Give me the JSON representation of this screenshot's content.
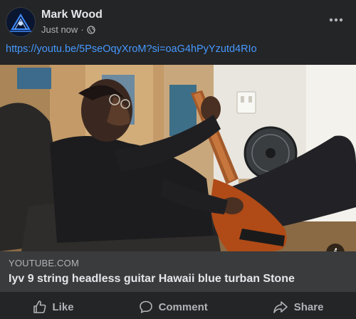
{
  "post": {
    "author": "Mark Wood",
    "time": "Just now",
    "separator": "·",
    "privacy_icon": "globe-icon",
    "link_text": "https://youtu.be/5PseOqyXroM?si=oaG4hPyYzutd4RIo"
  },
  "preview": {
    "domain": "YOUTUBE.COM",
    "title": "Iyv 9 string headless guitar Hawaii blue turban Stone"
  },
  "actions": {
    "like": "Like",
    "comment": "Comment",
    "share": "Share"
  },
  "colors": {
    "background": "#242526",
    "caption_background": "#3a3b3c",
    "link": "#4599ff",
    "text_primary": "#e4e6eb",
    "text_secondary": "#b0b3b8"
  }
}
